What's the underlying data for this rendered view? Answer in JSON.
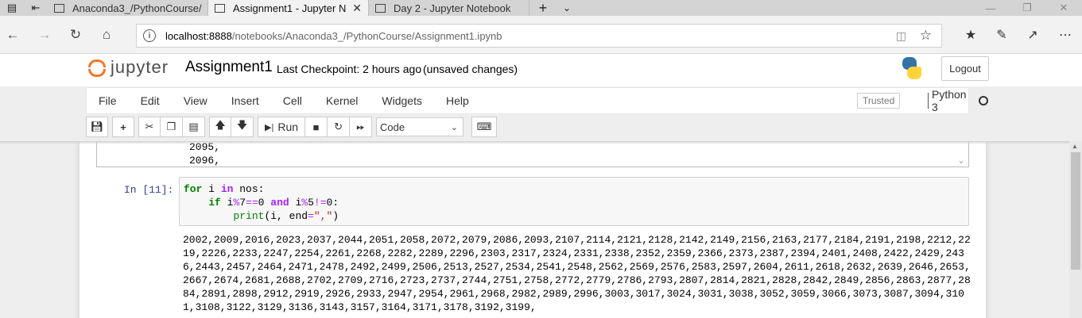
{
  "browser": {
    "tabs": [
      {
        "title": "Anaconda3_/PythonCourse/"
      },
      {
        "title": "Assignment1 - Jupyter N",
        "active": true
      },
      {
        "title": "Day 2 - Jupyter Notebook"
      }
    ],
    "address": {
      "host": "localhost:8888",
      "path": "/notebooks/Anaconda3_/PythonCourse/Assignment1.ipynb"
    }
  },
  "header": {
    "logo_text": "jupyter",
    "notebook_name": "Assignment1",
    "checkpoint": "Last Checkpoint: 2 hours ago",
    "unsaved": "(unsaved changes)",
    "logout_label": "Logout"
  },
  "menubar": {
    "items": [
      "File",
      "Edit",
      "View",
      "Insert",
      "Cell",
      "Kernel",
      "Widgets",
      "Help"
    ],
    "trusted": "Trusted",
    "kernel_name": "Python 3"
  },
  "toolbar": {
    "run_label": "Run",
    "cell_type": "Code"
  },
  "notebook": {
    "previous_output": [
      "2095,",
      "2096,"
    ],
    "cell": {
      "prompt": "In [11]:",
      "output_lines": [
        "2002,2009,2016,2023,2037,2044,2051,2058,2072,2079,2086,2093,2107,2114,2121,2128,2142,2149,2156,2163,2177,2184,2191,2198,2212,22",
        "19,2226,2233,2247,2254,2261,2268,2282,2289,2296,2303,2317,2324,2331,2338,2352,2359,2366,2373,2387,2394,2401,2408,2422,2429,243",
        "6,2443,2457,2464,2471,2478,2492,2499,2506,2513,2527,2534,2541,2548,2562,2569,2576,2583,2597,2604,2611,2618,2632,2639,2646,2653,",
        "2667,2674,2681,2688,2702,2709,2716,2723,2737,2744,2751,2758,2772,2779,2786,2793,2807,2814,2821,2828,2842,2849,2856,2863,2877,28",
        "84,2891,2898,2912,2919,2926,2933,2947,2954,2961,2968,2982,2989,2996,3003,3017,3024,3031,3038,3052,3059,3066,3073,3087,3094,310",
        "1,3108,3122,3129,3136,3143,3157,3164,3171,3178,3192,3199,"
      ]
    }
  }
}
